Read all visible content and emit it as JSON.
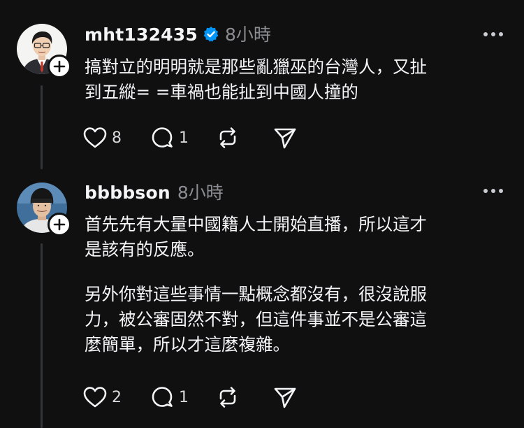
{
  "posts": [
    {
      "username": "mht132435",
      "time": "8小時",
      "verified": true,
      "text": "搞對立的明明就是那些亂獵巫的台灣人，又扯\n到五縱= =車禍也能扯到中國人撞的",
      "text2": "",
      "likes": "8",
      "replies": "1",
      "avatar_icon": "person-photo-avatar",
      "follow_icon": "plus-icon"
    },
    {
      "username": "bbbbson",
      "time": "8小時",
      "verified": false,
      "text": "首先先有大量中國籍人士開始直播，所以這才\n是該有的反應。",
      "text2": "另外你對這些事情一點概念都沒有，很沒說服\n力，被公審固然不對，但這件事並不是公審這\n麼簡單，所以才這麼複雜。",
      "likes": "2",
      "replies": "1",
      "avatar_icon": "person-photo-avatar",
      "follow_icon": "plus-icon"
    }
  ],
  "colors": {
    "background": "#101010",
    "text": "#f3f5f7",
    "muted": "#8a8d91",
    "verified": "#0095f6",
    "thread_line": "#333638"
  }
}
